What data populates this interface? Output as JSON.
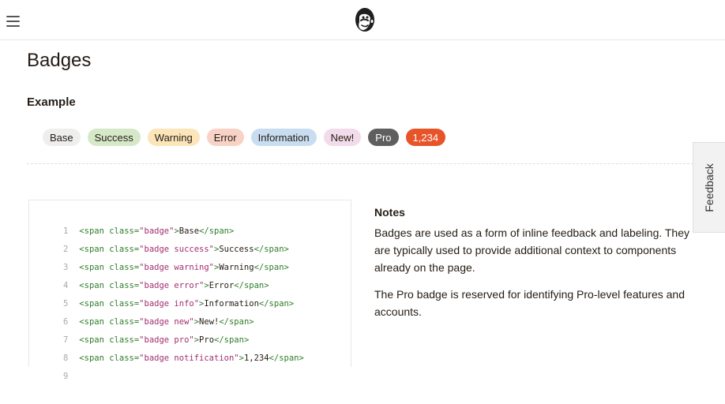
{
  "header": {
    "menu_icon": "hamburger-menu-icon",
    "logo": "mailchimp-freddie-logo"
  },
  "page": {
    "title": "Badges"
  },
  "example": {
    "heading": "Example",
    "badges": [
      {
        "label": "Base",
        "variant": "base",
        "color": "#eeeeed"
      },
      {
        "label": "Success",
        "variant": "success",
        "color": "#d5e8c8"
      },
      {
        "label": "Warning",
        "variant": "warning",
        "color": "#fbe5b9"
      },
      {
        "label": "Error",
        "variant": "error",
        "color": "#f8d2c6"
      },
      {
        "label": "Information",
        "variant": "info",
        "color": "#c9ddf1"
      },
      {
        "label": "New!",
        "variant": "new",
        "color": "#f2dbea"
      },
      {
        "label": "Pro",
        "variant": "pro",
        "color": "#5f5f5f"
      },
      {
        "label": "1,234",
        "variant": "notification",
        "color": "#e8542a"
      }
    ]
  },
  "code": {
    "lines": [
      {
        "n": "1",
        "open_tag": "<span",
        "attr": " class=",
        "value": "\"badge\"",
        "close_bracket": ">",
        "text": "Base",
        "end_tag": "</span>"
      },
      {
        "n": "2",
        "open_tag": "<span",
        "attr": " class=",
        "value": "\"badge success\"",
        "close_bracket": ">",
        "text": "Success",
        "end_tag": "</span>"
      },
      {
        "n": "3",
        "open_tag": "<span",
        "attr": " class=",
        "value": "\"badge warning\"",
        "close_bracket": ">",
        "text": "Warning",
        "end_tag": "</span>"
      },
      {
        "n": "4",
        "open_tag": "<span",
        "attr": " class=",
        "value": "\"badge error\"",
        "close_bracket": ">",
        "text": "Error",
        "end_tag": "</span>"
      },
      {
        "n": "5",
        "open_tag": "<span",
        "attr": " class=",
        "value": "\"badge info\"",
        "close_bracket": ">",
        "text": "Information",
        "end_tag": "</span>"
      },
      {
        "n": "6",
        "open_tag": "<span",
        "attr": " class=",
        "value": "\"badge new\"",
        "close_bracket": ">",
        "text": "New!",
        "end_tag": "</span>"
      },
      {
        "n": "7",
        "open_tag": "<span",
        "attr": " class=",
        "value": "\"badge pro\"",
        "close_bracket": ">",
        "text": "Pro",
        "end_tag": "</span>"
      },
      {
        "n": "8",
        "open_tag": "<span",
        "attr": " class=",
        "value": "\"badge notification\"",
        "close_bracket": ">",
        "text": "1,234",
        "end_tag": "</span>"
      },
      {
        "n": "9",
        "open_tag": "",
        "attr": "",
        "value": "",
        "close_bracket": "",
        "text": "",
        "end_tag": ""
      }
    ]
  },
  "notes": {
    "title": "Notes",
    "paragraphs": [
      "Badges are used as a form of inline feedback and labeling. They are typically used to provide additional context to components already on the page.",
      "The Pro badge is reserved for identifying Pro-level features and accounts."
    ]
  },
  "feedback": {
    "label": "Feedback"
  }
}
